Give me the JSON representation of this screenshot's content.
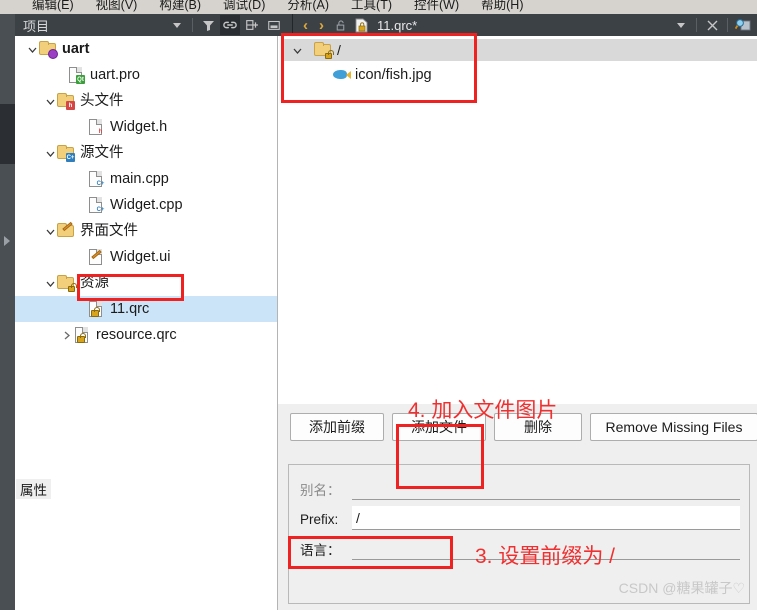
{
  "menubar": {
    "items": [
      {
        "label": "编辑(E)"
      },
      {
        "label": "视图(V)"
      },
      {
        "label": "构建(B)"
      },
      {
        "label": "调试(D)"
      },
      {
        "label": "分析(A)"
      },
      {
        "label": "工具(T)"
      },
      {
        "label": "控件(W)"
      },
      {
        "label": "帮助(H)"
      }
    ]
  },
  "panel_header": {
    "title": "项目",
    "document_name": "11.qrc*",
    "left_tools": [
      {
        "name": "filter-dropdown-arrow-icon"
      },
      {
        "name": "filter-icon"
      },
      {
        "name": "link-sync-icon"
      },
      {
        "name": "split-add-icon"
      },
      {
        "name": "minimize-panel-icon"
      }
    ],
    "right_tools": [
      {
        "name": "navigate-back-icon",
        "glyph": "‹"
      },
      {
        "name": "navigate-forward-icon",
        "glyph": "›"
      },
      {
        "name": "unlock-icon"
      },
      {
        "name": "qrc-file-icon"
      }
    ],
    "far_right_tools": [
      {
        "name": "document-dropdown-arrow-icon"
      },
      {
        "name": "close-document-icon"
      },
      {
        "name": "split-editor-icon"
      }
    ]
  },
  "project_tree": {
    "rows": [
      {
        "label": "uart",
        "icon": "folder-gear-icon",
        "indent": 0,
        "twisty": "expanded",
        "bold": true,
        "selected": false
      },
      {
        "label": "uart.pro",
        "icon": "pro-file-icon",
        "indent": 1,
        "twisty": "none",
        "bold": false,
        "selected": false
      },
      {
        "label": "头文件",
        "icon": "folder-h-icon",
        "indent": 1,
        "twisty": "expanded",
        "bold": false,
        "selected": false
      },
      {
        "label": "Widget.h",
        "icon": "h-file-icon",
        "indent": 2,
        "twisty": "none",
        "bold": false,
        "selected": false
      },
      {
        "label": "源文件",
        "icon": "folder-cpp-icon",
        "indent": 1,
        "twisty": "expanded",
        "bold": false,
        "selected": false
      },
      {
        "label": "main.cpp",
        "icon": "cpp-file-icon",
        "indent": 2,
        "twisty": "none",
        "bold": false,
        "selected": false
      },
      {
        "label": "Widget.cpp",
        "icon": "cpp-file-icon",
        "indent": 2,
        "twisty": "none",
        "bold": false,
        "selected": false
      },
      {
        "label": "界面文件",
        "icon": "folder-ui-icon",
        "indent": 1,
        "twisty": "expanded",
        "bold": false,
        "selected": false
      },
      {
        "label": "Widget.ui",
        "icon": "ui-file-icon",
        "indent": 2,
        "twisty": "none",
        "bold": false,
        "selected": false
      },
      {
        "label": "资源",
        "icon": "folder-qrc-icon",
        "indent": 1,
        "twisty": "expanded",
        "bold": false,
        "selected": false
      },
      {
        "label": "11.qrc",
        "icon": "qrc-file-icon",
        "indent": 2,
        "twisty": "none",
        "bold": false,
        "selected": true
      },
      {
        "label": "resource.qrc",
        "icon": "qrc-file-icon",
        "indent": 2,
        "twisty": "collapsed",
        "bold": false,
        "selected": false
      }
    ]
  },
  "qrc_editor": {
    "root_label": "/",
    "root_icon": "folder-qrc-icon",
    "child_label": "icon/fish.jpg",
    "child_icon": "fish-image-icon"
  },
  "buttons": {
    "add_prefix": "添加前缀",
    "add_file": "添加文件",
    "remove": "删除",
    "remove_missing": "Remove Missing Files"
  },
  "properties": {
    "group_title": "属性",
    "alias_label": "别名：",
    "alias_value": "",
    "prefix_label": "Prefix:",
    "prefix_value": "/",
    "language_label": "语言：",
    "language_value": ""
  },
  "annotations": {
    "step4": "4. 加入文件图片",
    "step3": "3. 设置前缀为 /",
    "accent_color": "#f03030"
  },
  "watermark": {
    "text": "CSDN @糖果罐子♡"
  }
}
